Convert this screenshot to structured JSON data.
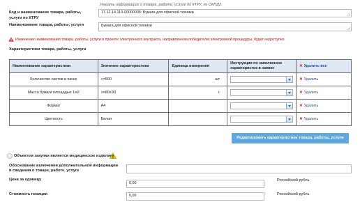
{
  "hint_ktru": "Указать информацию о товаре, работе, услуге по КТРУ, по ОКПД2.",
  "ktru": {
    "label": "Код и наименование товара, работы, услуги по КТРУ",
    "value": "17.12.14.110-00000005: Бумага для офисной техники"
  },
  "name": {
    "label": "Наименование товара, работы, услуги",
    "value": "Бумага для офисной техники"
  },
  "warning": {
    "icon": "warning-triangle-icon",
    "text": "Изменение наименования товара, работы, услуги в проекте электронного контракта, направленном победителю электронной процедуры, будет недоступно"
  },
  "characteristics": {
    "section_title": "Характеристики товара, работы, услуги",
    "headers": {
      "name": "Наименование характеристики",
      "value": "Значение характеристики",
      "unit": "Единица измерения",
      "instruction": "Инструкция по заполнению характеристик в заявке",
      "delete_all": "Удалить все"
    },
    "rows": [
      {
        "name": "Количество листов в пачке",
        "value": ">=500",
        "unit": "шт",
        "delete": "Удалить"
      },
      {
        "name": "Масса бумаги площадью 1м2",
        "value": ">=80<90",
        "unit": "г",
        "delete": "Удалить"
      },
      {
        "name": "Формат",
        "value": "А4",
        "unit": "",
        "delete": "Удалить"
      },
      {
        "name": "Цветность",
        "value": "Белая",
        "unit": "",
        "delete": "Удалить"
      }
    ],
    "edit_button": "Редактировать характеристики товара, работы, услуги"
  },
  "medical": {
    "label": "Объектом закупки является медицинское изделие"
  },
  "justification": {
    "label": "Обоснование включения дополнительной информации в сведения о товаре, работе, услуге",
    "value": ""
  },
  "unit_price": {
    "label": "Цена за единицу",
    "value": "0,00",
    "currency": "Российский рубль"
  },
  "position_cost": {
    "label": "Стоимость позиции",
    "value": "0,00",
    "currency": "Российский рубль"
  },
  "colors": {
    "header_bg": "#dfe8f3",
    "button_bg": "#5fa8df",
    "warning_text": "#d00000",
    "delete_x": "#d40000"
  }
}
